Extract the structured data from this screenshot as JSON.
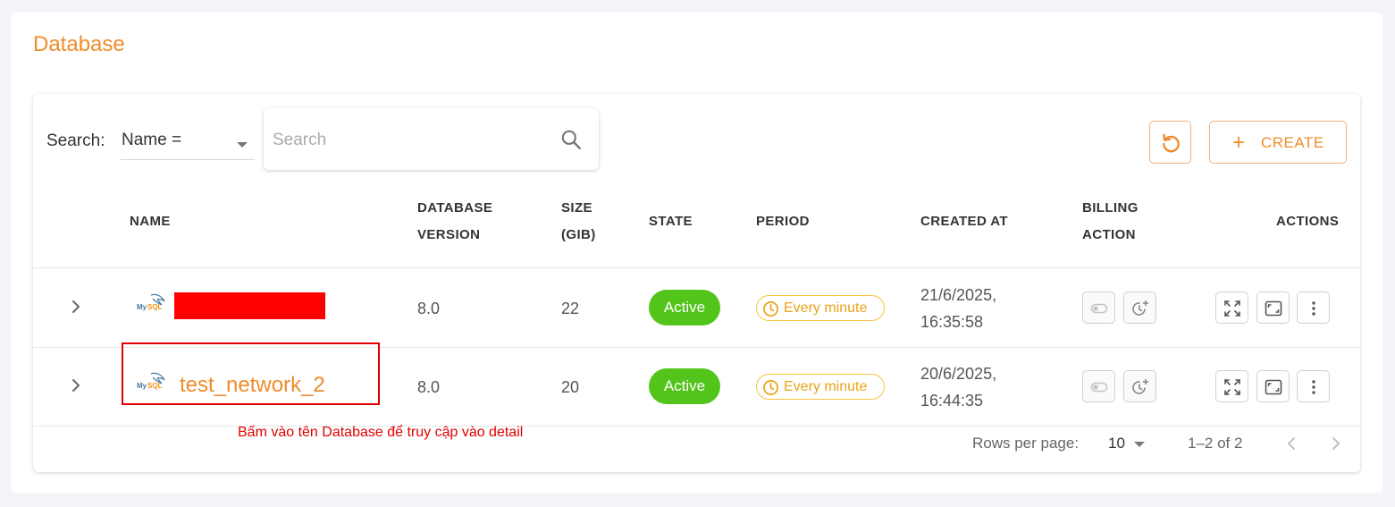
{
  "page": {
    "title": "Database"
  },
  "toolbar": {
    "search_label": "Search:",
    "filter_value": "Name =",
    "search_placeholder": "Search",
    "create_label": "CREATE",
    "accent_color": "#f08c2b"
  },
  "table": {
    "headers": {
      "name": "NAME",
      "version_l1": "DATABASE",
      "version_l2": "VERSION",
      "size_l1": "SIZE",
      "size_l2": "(GIB)",
      "state": "STATE",
      "period": "PERIOD",
      "created": "CREATED AT",
      "billing_l1": "BILLING",
      "billing_l2": "ACTION",
      "actions": "ACTIONS"
    },
    "rows": [
      {
        "name": "",
        "name_redacted": true,
        "engine_icon": "mysql-logo",
        "version": "8.0",
        "size": "22",
        "state": "Active",
        "period": "Every minute",
        "created_date": "21/6/2025,",
        "created_time": "16:35:58"
      },
      {
        "name": "test_network_2",
        "name_redacted": false,
        "engine_icon": "mysql-logo",
        "version": "8.0",
        "size": "20",
        "state": "Active",
        "period": "Every minute",
        "created_date": "20/6/2025,",
        "created_time": "16:44:35"
      }
    ]
  },
  "annotation": {
    "note": "Bấm vào tên Database để truy cập vào detail",
    "color": "#e00000"
  },
  "pagination": {
    "rows_per_page_label": "Rows per page:",
    "rows_per_page": "10",
    "range": "1–2 of 2"
  },
  "colors": {
    "active": "#52c41a",
    "period": "#e8a317"
  }
}
